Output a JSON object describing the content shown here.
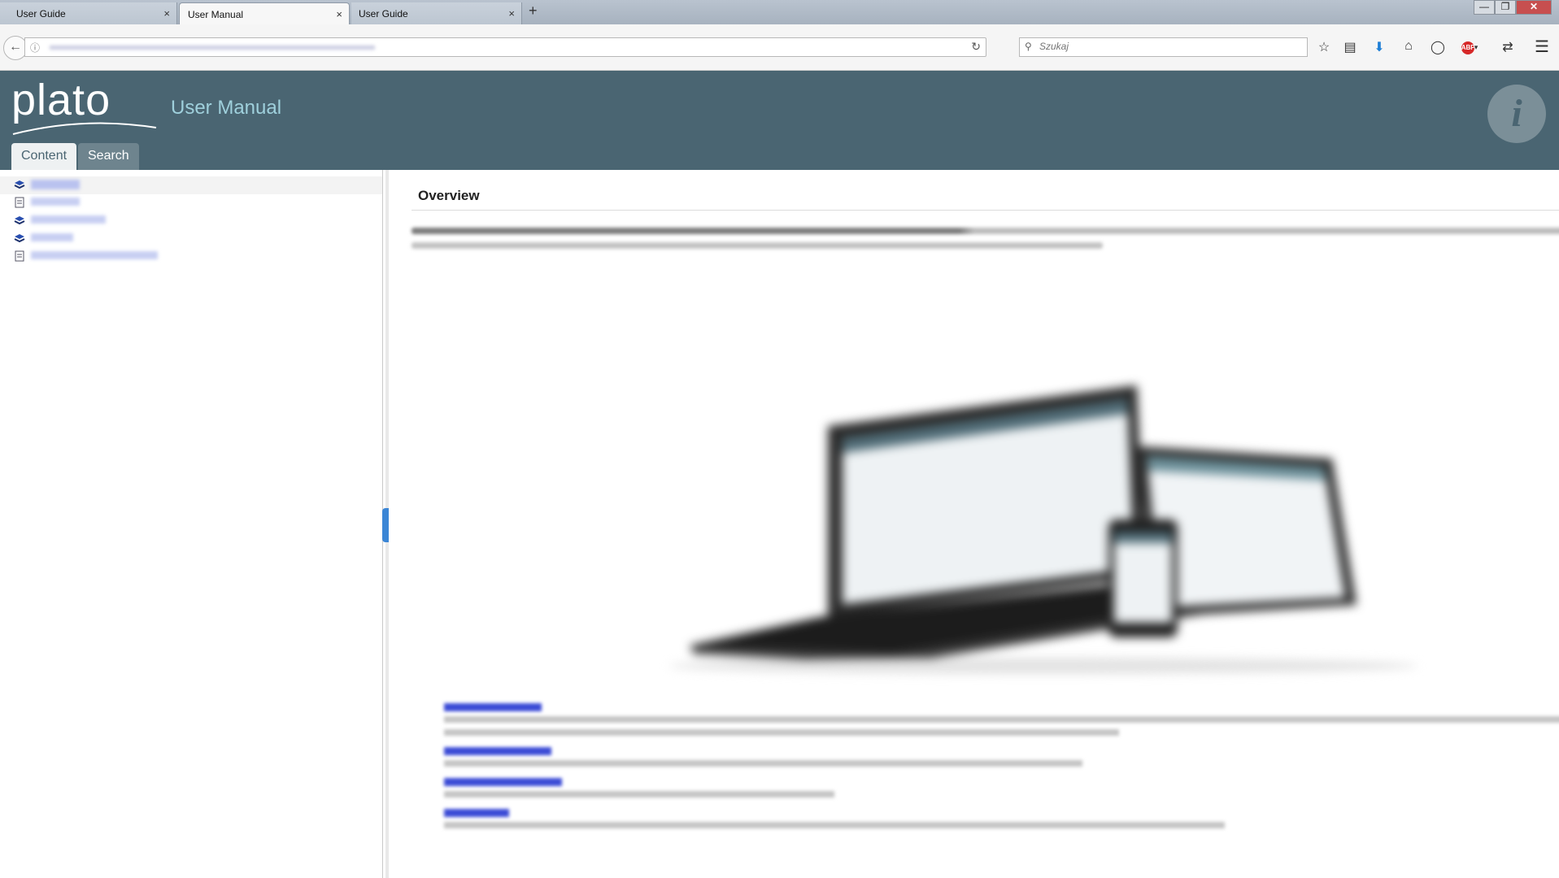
{
  "browser": {
    "tabs": [
      {
        "label": "User Guide",
        "active": false
      },
      {
        "label": "User Manual",
        "active": true
      },
      {
        "label": "User Guide",
        "active": false
      }
    ],
    "new_tab_label": "+",
    "close_glyph": "×",
    "search_placeholder": "Szukaj",
    "icons": [
      "back-icon",
      "info-icon",
      "reload-icon",
      "search-icon",
      "star-icon",
      "reading-list-icon",
      "download-icon",
      "home-icon",
      "pocket-icon",
      "adblock-icon",
      "sync-icon",
      "menu-icon"
    ],
    "adblock_label": "ABP"
  },
  "app": {
    "logo_text": "plato",
    "title": "User Manual",
    "tabs": {
      "content": "Content",
      "search": "Search"
    },
    "info_glyph": "i",
    "colors": {
      "header": "#4a6572",
      "title": "#9fd0dc",
      "link": "#2a3ccf"
    }
  },
  "main": {
    "page_title": "Overview"
  }
}
